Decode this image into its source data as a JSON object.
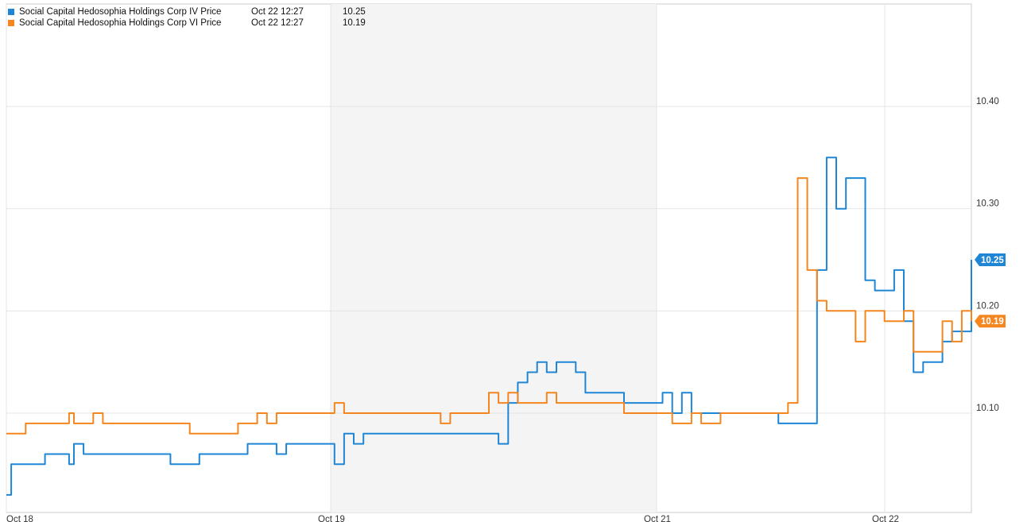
{
  "legend": [
    {
      "name": "Social Capital Hedosophia Holdings Corp IV Price",
      "time": "Oct 22 12:27",
      "value": "10.25",
      "color": "#1f86d6"
    },
    {
      "name": "Social Capital Hedosophia Holdings Corp VI Price",
      "time": "Oct 22 12:27",
      "value": "10.19",
      "color": "#f5851f"
    }
  ],
  "chart_data": {
    "type": "line",
    "ylim": [
      10.0,
      10.5
    ],
    "y_ticks": [
      "10.10",
      "10.20",
      "10.30",
      "10.40"
    ],
    "x_ticks": [
      "Oct 18",
      "Oct 19",
      "Oct 21",
      "Oct 22"
    ],
    "grid": true,
    "legend_position": "top-left",
    "series": [
      {
        "name": "Social Capital Hedosophia Holdings Corp IV Price",
        "color": "#1f86d6",
        "end_label": "10.25",
        "x": [
          0.0,
          0.3,
          0.5,
          1.0,
          2.0,
          4.0,
          6.0,
          6.5,
          7.0,
          8.0,
          9.0,
          10.0,
          11.0,
          13.0,
          14.0,
          15.0,
          16.0,
          17.0,
          18.0,
          19.0,
          20.0,
          21.0,
          22.0,
          23.0,
          24.0,
          25.0,
          26.0,
          27.0,
          28.0,
          29.0,
          30.0,
          31.0,
          32.0,
          33.0,
          34.0,
          35.0,
          36.0,
          37.0,
          38.0,
          39.0,
          40.0,
          41.0,
          42.0,
          43.0,
          44.0,
          45.0,
          46.0,
          47.0,
          48.0,
          49.0,
          50.0,
          51.0,
          52.0,
          53.0,
          54.0,
          55.0,
          56.0,
          57.0,
          58.0,
          59.0,
          60.0,
          61.0,
          62.0,
          63.0,
          64.0,
          65.0,
          66.0,
          67.0,
          68.0,
          69.0,
          70.0,
          71.0,
          72.0,
          73.0,
          74.0,
          75.0,
          76.0,
          77.0,
          78.0,
          79.0,
          80.0,
          81.0,
          82.0,
          83.0,
          84.0,
          85.0,
          86.0,
          87.0,
          88.0,
          89.0,
          90.0,
          91.0,
          92.0,
          93.0,
          94.0,
          95.0,
          96.0,
          97.0,
          98.0,
          99.0,
          100.0
        ],
        "values": [
          10.02,
          10.02,
          10.05,
          10.05,
          10.05,
          10.06,
          10.06,
          10.05,
          10.07,
          10.06,
          10.06,
          10.06,
          10.06,
          10.06,
          10.06,
          10.06,
          10.06,
          10.05,
          10.05,
          10.05,
          10.06,
          10.06,
          10.06,
          10.06,
          10.06,
          10.07,
          10.07,
          10.07,
          10.06,
          10.07,
          10.07,
          10.07,
          10.07,
          10.07,
          10.05,
          10.08,
          10.07,
          10.08,
          10.08,
          10.08,
          10.08,
          10.08,
          10.08,
          10.08,
          10.08,
          10.08,
          10.08,
          10.08,
          10.08,
          10.08,
          10.08,
          10.07,
          10.11,
          10.13,
          10.14,
          10.15,
          10.14,
          10.15,
          10.15,
          10.14,
          10.12,
          10.12,
          10.12,
          10.12,
          10.11,
          10.11,
          10.11,
          10.11,
          10.12,
          10.1,
          10.12,
          10.1,
          10.1,
          10.1,
          10.1,
          10.1,
          10.1,
          10.1,
          10.1,
          10.1,
          10.09,
          10.09,
          10.09,
          10.09,
          10.24,
          10.35,
          10.3,
          10.33,
          10.33,
          10.23,
          10.22,
          10.22,
          10.24,
          10.19,
          10.14,
          10.15,
          10.15,
          10.17,
          10.18,
          10.18,
          10.25
        ]
      },
      {
        "name": "Social Capital Hedosophia Holdings Corp VI Price",
        "color": "#f5851f",
        "end_label": "10.19",
        "x": [
          0.0,
          0.3,
          0.5,
          1.0,
          2.0,
          4.0,
          6.0,
          6.5,
          7.0,
          8.0,
          9.0,
          10.0,
          11.0,
          13.0,
          14.0,
          15.0,
          16.0,
          17.0,
          18.0,
          19.0,
          20.0,
          21.0,
          22.0,
          23.0,
          24.0,
          25.0,
          26.0,
          27.0,
          28.0,
          29.0,
          30.0,
          31.0,
          32.0,
          33.0,
          34.0,
          35.0,
          36.0,
          37.0,
          38.0,
          39.0,
          40.0,
          41.0,
          42.0,
          43.0,
          44.0,
          45.0,
          46.0,
          47.0,
          48.0,
          49.0,
          50.0,
          51.0,
          52.0,
          53.0,
          54.0,
          55.0,
          56.0,
          57.0,
          58.0,
          59.0,
          60.0,
          61.0,
          62.0,
          63.0,
          64.0,
          65.0,
          66.0,
          67.0,
          68.0,
          69.0,
          70.0,
          71.0,
          72.0,
          73.0,
          74.0,
          75.0,
          76.0,
          77.0,
          78.0,
          79.0,
          80.0,
          81.0,
          82.0,
          83.0,
          84.0,
          85.0,
          86.0,
          87.0,
          88.0,
          89.0,
          90.0,
          91.0,
          92.0,
          93.0,
          94.0,
          95.0,
          96.0,
          97.0,
          98.0,
          99.0,
          100.0
        ],
        "values": [
          10.08,
          10.08,
          10.08,
          10.08,
          10.09,
          10.09,
          10.09,
          10.1,
          10.09,
          10.09,
          10.1,
          10.09,
          10.09,
          10.09,
          10.09,
          10.09,
          10.09,
          10.09,
          10.09,
          10.08,
          10.08,
          10.08,
          10.08,
          10.08,
          10.09,
          10.09,
          10.1,
          10.09,
          10.1,
          10.1,
          10.1,
          10.1,
          10.1,
          10.1,
          10.11,
          10.1,
          10.1,
          10.1,
          10.1,
          10.1,
          10.1,
          10.1,
          10.1,
          10.1,
          10.1,
          10.09,
          10.1,
          10.1,
          10.1,
          10.1,
          10.12,
          10.11,
          10.12,
          10.11,
          10.11,
          10.11,
          10.12,
          10.11,
          10.11,
          10.11,
          10.11,
          10.11,
          10.11,
          10.11,
          10.1,
          10.1,
          10.1,
          10.1,
          10.1,
          10.09,
          10.09,
          10.1,
          10.09,
          10.09,
          10.1,
          10.1,
          10.1,
          10.1,
          10.1,
          10.1,
          10.1,
          10.11,
          10.33,
          10.24,
          10.21,
          10.2,
          10.2,
          10.2,
          10.17,
          10.2,
          10.2,
          10.19,
          10.19,
          10.2,
          10.16,
          10.16,
          10.16,
          10.19,
          10.17,
          10.2,
          10.19
        ]
      }
    ]
  }
}
